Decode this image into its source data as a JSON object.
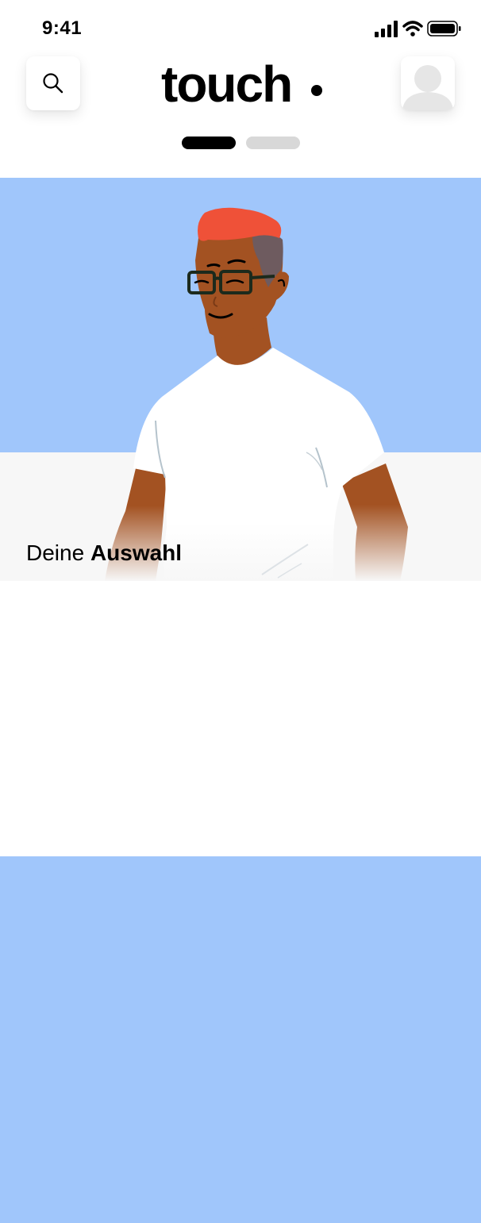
{
  "status_bar": {
    "time": "9:41",
    "icons": [
      "cellular-signal-icon",
      "wifi-icon",
      "battery-icon"
    ]
  },
  "header": {
    "search_icon": "search-icon",
    "logo_text": "touch",
    "profile_icon": "avatar-placeholder-icon"
  },
  "page_indicator": {
    "count": 2,
    "active_index": 0
  },
  "hero": {
    "caption_regular": "Deine ",
    "caption_bold": "Auswahl",
    "illustration": "person-illustration"
  },
  "colors": {
    "card_blue": "#a0c6fb",
    "card_gray": "#f7f7f7",
    "hair_red": "#ef5138",
    "skin": "#a35222",
    "indicator_active": "#000000",
    "indicator_inactive": "#d8d8d8"
  }
}
